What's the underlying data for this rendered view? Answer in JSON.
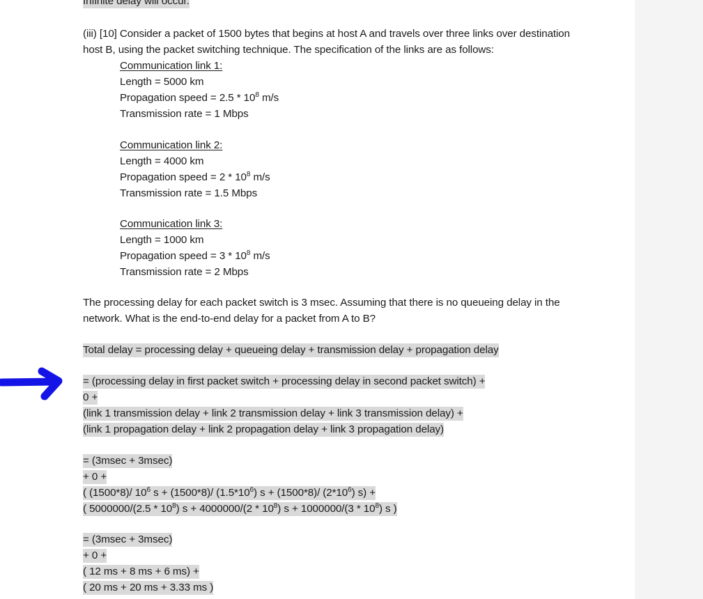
{
  "document": {
    "top_clipped_line": "Infinite delay will occur.",
    "question": {
      "line1": "(iii) [10] Consider a packet of 1500 bytes that begins at host A and travels over three links over destination",
      "line2": "host B, using the packet switching technique.  The specification of the links are as follows:"
    },
    "links": [
      {
        "heading": "Communication link 1:",
        "length": "Length = 5000 km",
        "propagation_speed_prefix": "Propagation speed = 2.5 * 10",
        "propagation_speed_exponent": "8",
        "propagation_speed_suffix": " m/s",
        "transmission_rate": "Transmission rate = 1 Mbps"
      },
      {
        "heading": "Communication link 2:",
        "length": "Length = 4000 km",
        "propagation_speed_prefix": "Propagation speed = 2 * 10",
        "propagation_speed_exponent": "8",
        "propagation_speed_suffix": " m/s",
        "transmission_rate": "Transmission rate = 1.5 Mbps"
      },
      {
        "heading": "Communication link 3:",
        "length": "Length = 1000 km",
        "propagation_speed_prefix": "Propagation speed = 3 * 10",
        "propagation_speed_exponent": "8",
        "propagation_speed_suffix": " m/s",
        "transmission_rate": "Transmission rate = 2 Mbps"
      }
    ],
    "prompt": {
      "line1": "The processing delay for each packet switch is 3 msec.  Assuming that there is no queueing delay in the",
      "line2": "network.  What is the end-to-end delay for a packet from A to B?"
    },
    "answer": {
      "total_delay": "Total delay = processing delay + queueing delay + transmission delay + propagation delay",
      "block1": {
        "line1": "= (processing delay in first packet switch + processing delay in second packet switch) +",
        "line2": "0 +",
        "line3": "(link 1 transmission delay + link 2 transmission delay + link 3 transmission delay) +",
        "line4": "(link 1 propagation delay + link 2 propagation delay + link 3 propagation delay)"
      },
      "block2": {
        "line1": "= (3msec + 3msec)",
        "line2": "+ 0 +",
        "line3_parts": [
          "( (1500*8)/ 10",
          "6",
          " s + (1500*8)/ (1.5*10",
          "6",
          ") s + (1500*8)/ (2*10",
          "6",
          ") s) +"
        ],
        "line4_parts": [
          "( 5000000/(2.5 * 10",
          "8",
          ") s + 4000000/(2 * 10",
          "8",
          ") s + 1000000/(3 * 10",
          "8",
          ") s )"
        ]
      },
      "block3": {
        "line1": "= (3msec + 3msec)",
        "line2": "+ 0 +",
        "line3": "( 12 ms + 8 ms + 6 ms) +",
        "line4": "( 20 ms + 20 ms + 3.33 ms )"
      }
    }
  },
  "annotation": {
    "arrow_color": "#1414e6",
    "arrow_label": "blue-arrow-pointing-right"
  },
  "colors": {
    "highlight": "#d9d9d9",
    "text": "#1a1a1a",
    "page_band": "#f4f4f4"
  }
}
